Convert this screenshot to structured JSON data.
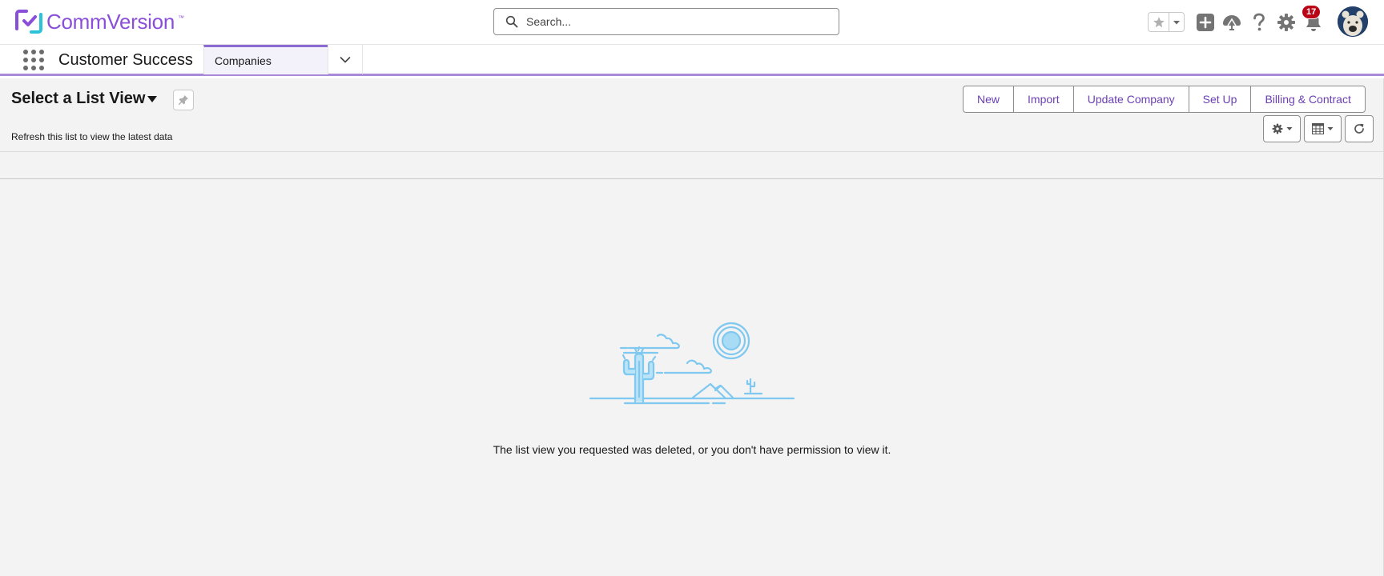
{
  "header": {
    "logo_text": "CommVersion",
    "logo_tm": "™",
    "search_label": "Search...",
    "notifications_count": "17",
    "brand_color": "#8a4fd9"
  },
  "nav": {
    "app_name": "Customer Success",
    "active_tab": "Companies"
  },
  "list_view": {
    "title": "Select a List View",
    "subtitle": "Refresh this list to view the latest data",
    "actions": [
      "New",
      "Import",
      "Update Company",
      "Set Up",
      "Billing & Contract"
    ],
    "empty_message": "The list view you requested was deleted, or you don't have permission to view it."
  },
  "icons": [
    "search-icon",
    "favorite-star-icon",
    "chevron-down-icon",
    "add-icon",
    "trailhead-icon",
    "help-icon",
    "setup-gear-icon",
    "notification-bell-icon",
    "avatar",
    "app-launcher-icon",
    "pin-icon",
    "list-settings-gear-icon",
    "display-as-table-icon",
    "refresh-icon",
    "empty-desert-illustration"
  ]
}
